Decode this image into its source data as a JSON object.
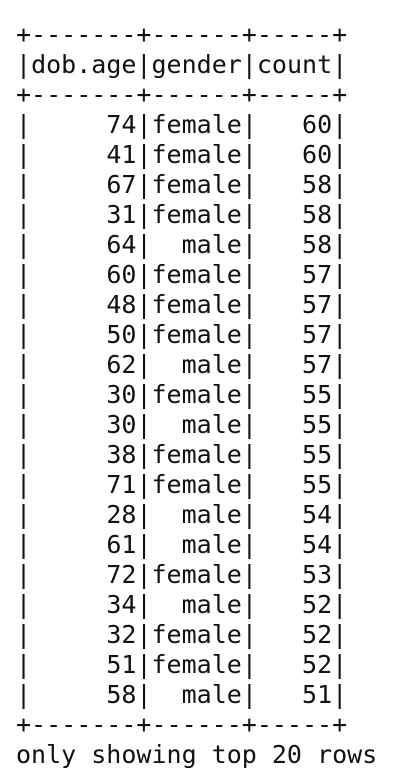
{
  "table": {
    "border": "+-------+------+-----+",
    "headers": [
      "dob.age",
      "gender",
      "count"
    ],
    "rows": [
      [
        "74",
        "female",
        "60"
      ],
      [
        "41",
        "female",
        "60"
      ],
      [
        "67",
        "female",
        "58"
      ],
      [
        "31",
        "female",
        "58"
      ],
      [
        "64",
        "male",
        "58"
      ],
      [
        "60",
        "female",
        "57"
      ],
      [
        "48",
        "female",
        "57"
      ],
      [
        "50",
        "female",
        "57"
      ],
      [
        "62",
        "male",
        "57"
      ],
      [
        "30",
        "female",
        "55"
      ],
      [
        "30",
        "male",
        "55"
      ],
      [
        "38",
        "female",
        "55"
      ],
      [
        "71",
        "female",
        "55"
      ],
      [
        "28",
        "male",
        "54"
      ],
      [
        "61",
        "male",
        "54"
      ],
      [
        "72",
        "female",
        "53"
      ],
      [
        "34",
        "male",
        "52"
      ],
      [
        "32",
        "female",
        "52"
      ],
      [
        "51",
        "female",
        "52"
      ],
      [
        "58",
        "male",
        "51"
      ]
    ]
  },
  "footer": "only showing top 20 rows"
}
